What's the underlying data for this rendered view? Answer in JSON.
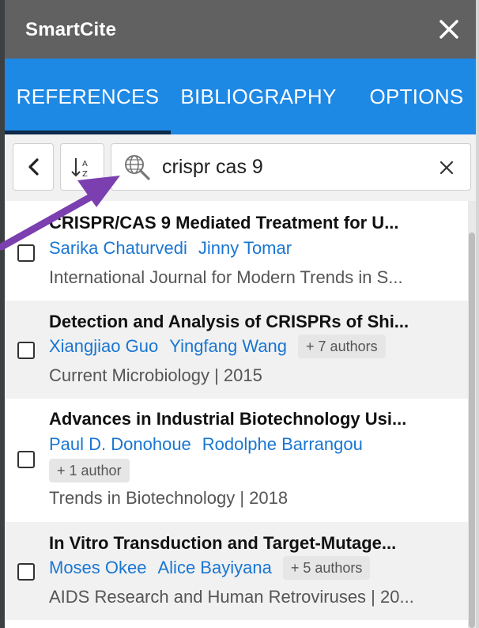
{
  "app": {
    "title": "SmartCite"
  },
  "tabs": [
    {
      "label": "REFERENCES",
      "active": true
    },
    {
      "label": "BIBLIOGRAPHY",
      "active": false
    },
    {
      "label": "OPTIONS",
      "active": false
    }
  ],
  "toolbar": {
    "search_value": "crispr cas 9",
    "back_icon": "chevron-left-icon",
    "sort_icon": "sort-alpha-icon",
    "search_icon": "globe-search-icon",
    "clear_icon": "close-icon"
  },
  "results": [
    {
      "title": "CRISPR/CAS 9 Mediated Treatment for U...",
      "authors": [
        "Sarika Chaturvedi",
        "Jinny Tomar"
      ],
      "more_authors": "",
      "source": "International Journal for Modern Trends in S..."
    },
    {
      "title": "Detection and Analysis of CRISPRs of Shi...",
      "authors": [
        "Xiangjiao Guo",
        "Yingfang Wang"
      ],
      "more_authors": "+ 7 authors",
      "source": "Current Microbiology | 2015"
    },
    {
      "title": "Advances in Industrial Biotechnology Usi...",
      "authors": [
        "Paul D. Donohoue",
        "Rodolphe Barrangou"
      ],
      "more_authors": "+ 1 author",
      "source": "Trends in Biotechnology | 2018"
    },
    {
      "title": "In Vitro Transduction and Target-Mutage...",
      "authors": [
        "Moses Okee",
        "Alice Bayiyana"
      ],
      "more_authors": "+ 5 authors",
      "source": "AIDS Research and Human Retroviruses | 20..."
    }
  ],
  "colors": {
    "titlebar": "#616161",
    "tabbar": "#1e88e5",
    "author_link": "#1976d2",
    "annotation_arrow": "#7b3fb0"
  }
}
